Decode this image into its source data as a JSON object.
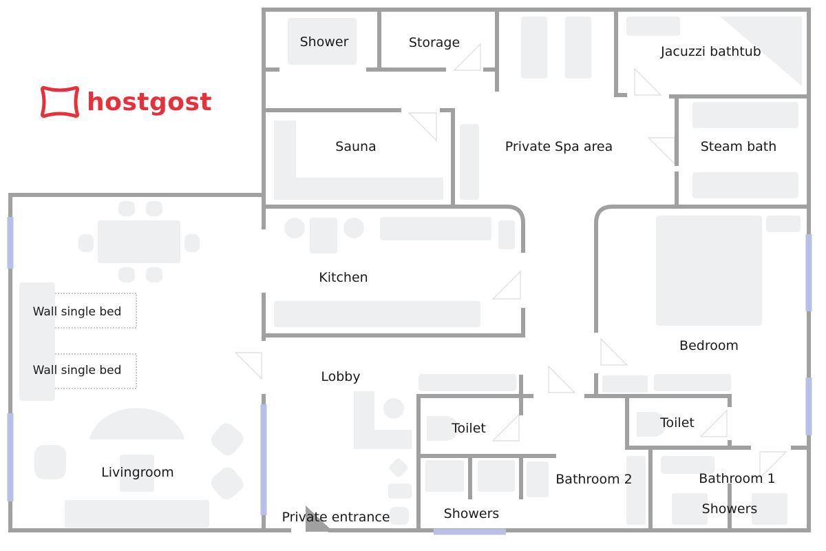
{
  "brand": {
    "name": "hostgost",
    "color": "#e8303a",
    "icon": "pillow-icon"
  },
  "colors": {
    "wall": "#a0a0a0",
    "furniture": "#eeeff1",
    "window": "#b9c0e6"
  },
  "rooms": {
    "shower": "Shower",
    "storage": "Storage",
    "jacuzzi": "Jacuzzi bathtub",
    "sauna": "Sauna",
    "spa": "Private Spa area",
    "steam": "Steam bath",
    "kitchen": "Kitchen",
    "bed1": "Wall single bed",
    "bed2": "Wall single bed",
    "lobby": "Lobby",
    "bedroom": "Bedroom",
    "toilet2": "Toilet",
    "toilet1": "Toilet",
    "bathroom2": "Bathroom 2",
    "bathroom1": "Bathroom 1",
    "livingroom": "Livingroom",
    "entrance": "Private entrance",
    "showers2": "Showers",
    "showers1": "Showers"
  }
}
